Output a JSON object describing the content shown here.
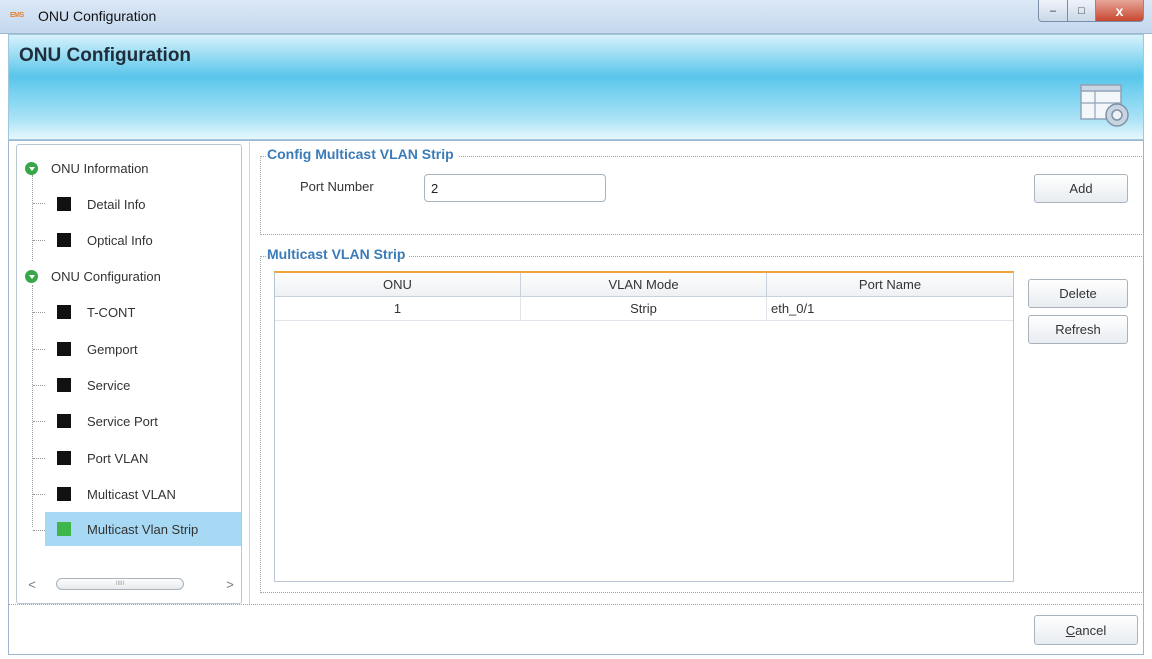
{
  "window": {
    "app_badge": "EMS",
    "title": "ONU Configuration",
    "controls": {
      "minimize": "–",
      "maximize": "□",
      "close": "x"
    }
  },
  "banner": {
    "title": "ONU Configuration",
    "icon": "config-window-icon"
  },
  "tree": {
    "groups": [
      {
        "label": "ONU Information",
        "icon": "expand-arrow-icon",
        "items": [
          "Detail Info",
          "Optical Info"
        ]
      },
      {
        "label": "ONU Configuration",
        "icon": "expand-arrow-icon",
        "items": [
          "T-CONT",
          "Gemport",
          "Service",
          "Service Port",
          "Port VLAN",
          "Multicast VLAN",
          "Multicast Vlan Strip"
        ]
      }
    ],
    "selected": "Multicast Vlan Strip",
    "scroll_thumb_grip": "IIIII"
  },
  "config_section": {
    "title": "Config Multicast VLAN Strip",
    "port_label": "Port Number",
    "port_value": "2",
    "add_label": "Add"
  },
  "strip_section": {
    "title": "Multicast VLAN Strip",
    "columns": [
      "ONU",
      "VLAN Mode",
      "Port Name"
    ],
    "rows": [
      [
        "1",
        "Strip",
        "eth_0/1"
      ]
    ],
    "delete_label": "Delete",
    "refresh_label": "Refresh"
  },
  "footer": {
    "cancel_label_first": "C",
    "cancel_label_rest": "ancel"
  },
  "colors": {
    "accent": "#3b7cb8",
    "selected_bg": "#a7d8f4",
    "group_icon": "#39a64a",
    "table_top_border": "#f0a53a"
  }
}
